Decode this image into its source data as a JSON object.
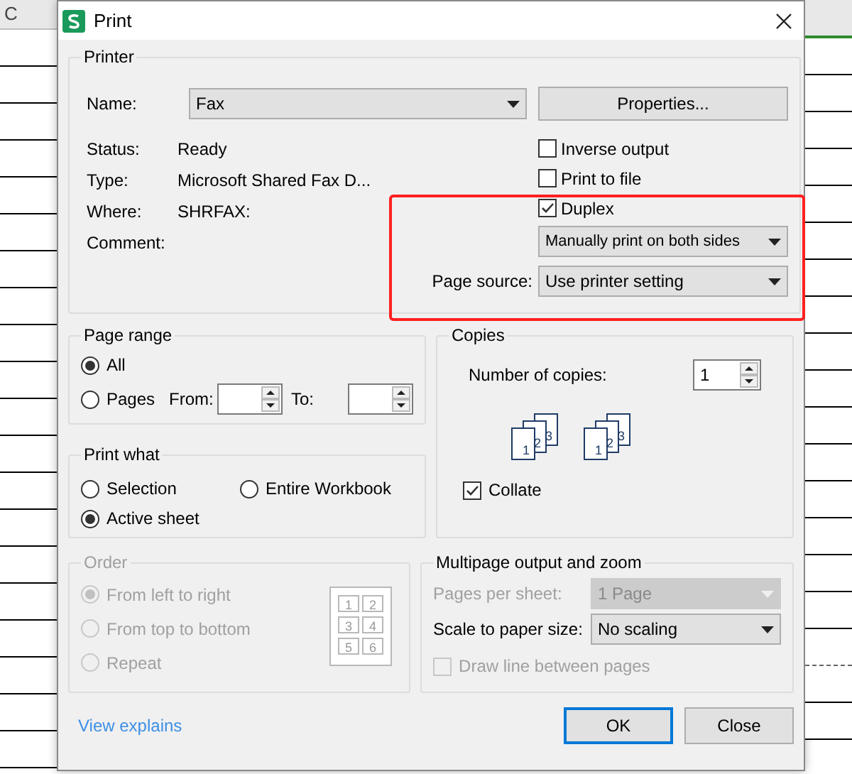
{
  "sheet": {
    "column_header": "C"
  },
  "window": {
    "title": "Print"
  },
  "printer": {
    "legend": "Printer",
    "name_label": "Name:",
    "name_value": "Fax",
    "properties_button": "Properties...",
    "info": [
      {
        "label": "Status:",
        "value": "Ready"
      },
      {
        "label": "Type:",
        "value": "Microsoft Shared Fax D..."
      },
      {
        "label": "Where:",
        "value": "SHRFAX:"
      },
      {
        "label": "Comment:"
      }
    ],
    "options": [
      {
        "label": "Inverse output",
        "checked": false
      },
      {
        "label": "Print to file",
        "checked": false
      },
      {
        "label": "Duplex",
        "checked": true
      }
    ],
    "duplex_mode": "Manually print on both sides",
    "page_source_label": "Page source:",
    "page_source": "Use printer setting"
  },
  "page_range": {
    "legend": "Page range",
    "options": [
      {
        "label": "All",
        "selected": true
      },
      {
        "label": "Pages",
        "selected": false
      }
    ],
    "from_label": "From:",
    "to_label": "To:"
  },
  "print_what": {
    "legend": "Print what",
    "options": [
      {
        "label": "Selection",
        "selected": false
      },
      {
        "label": "Entire Workbook",
        "selected": false
      },
      {
        "label": "Active sheet",
        "selected": true
      }
    ]
  },
  "copies": {
    "legend": "Copies",
    "count_label": "Number of copies:",
    "count": "1",
    "stacks": [
      {
        "numbers": [
          "1",
          "2",
          "3"
        ]
      },
      {
        "numbers": [
          "1",
          "2",
          "3"
        ]
      }
    ],
    "collate": {
      "label": "Collate",
      "checked": true
    }
  },
  "order": {
    "legend": "Order",
    "disabled": true,
    "options": [
      {
        "label": "From left to right",
        "selected": true
      },
      {
        "label": "From top to bottom",
        "selected": false
      },
      {
        "label": "Repeat",
        "selected": false
      }
    ],
    "grid_numbers": [
      "1",
      "2",
      "3",
      "4",
      "5",
      "6"
    ]
  },
  "multipage": {
    "legend": "Multipage output and zoom",
    "pages_per_sheet_label": "Pages per sheet:",
    "pages_per_sheet": "1 Page",
    "pages_per_sheet_disabled": true,
    "scale_label": "Scale to paper size:",
    "scale": "No scaling",
    "draw_line": {
      "label": "Draw line between pages",
      "checked": false,
      "disabled": true
    }
  },
  "footer": {
    "link": "View explains",
    "buttons": [
      {
        "label": "OK",
        "default": true
      },
      {
        "label": "Close",
        "default": false
      }
    ]
  }
}
